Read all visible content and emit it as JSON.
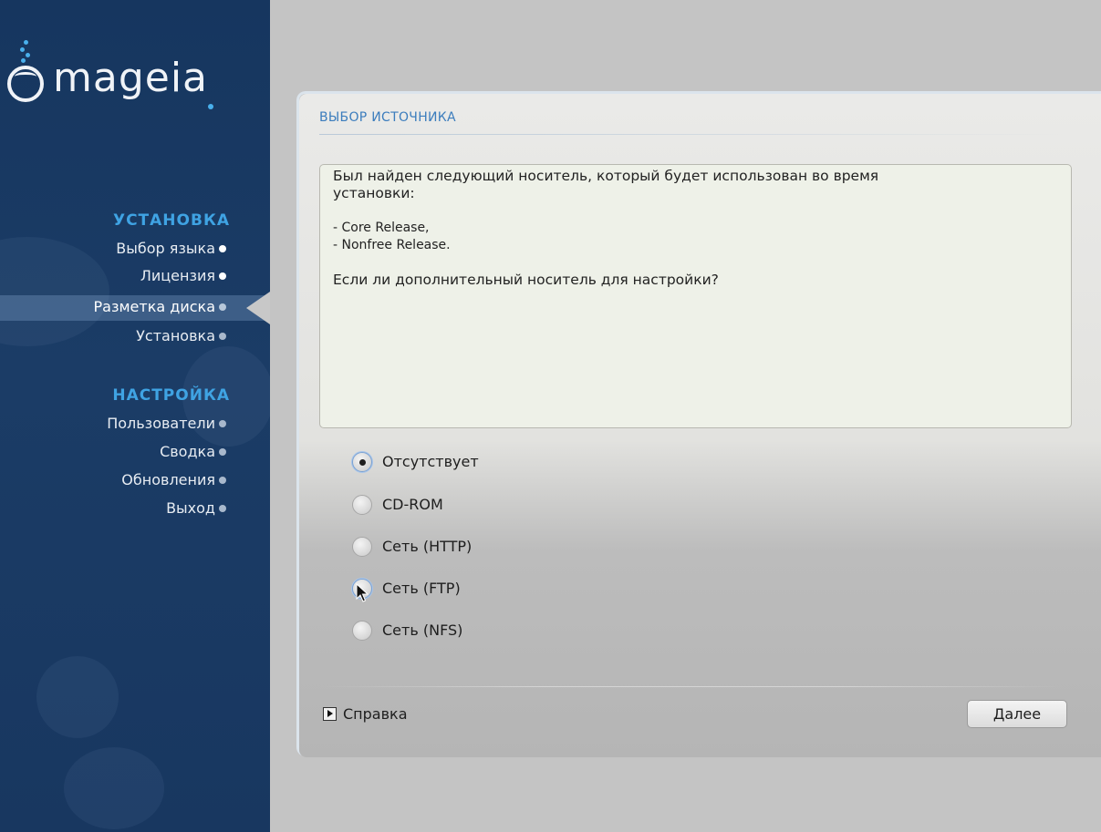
{
  "window": {
    "title": ""
  },
  "brand": {
    "logo_text": "mageia"
  },
  "sidebar": {
    "sections": [
      {
        "title": "УСТАНОВКА",
        "items": [
          {
            "label": "Выбор языка",
            "state": "done"
          },
          {
            "label": "Лицензия",
            "state": "done"
          },
          {
            "label": "Разметка диска",
            "state": "active"
          },
          {
            "label": "Установка",
            "state": "pending"
          }
        ]
      },
      {
        "title": "НАСТРОЙКА",
        "items": [
          {
            "label": "Пользователи",
            "state": "pending"
          },
          {
            "label": "Сводка",
            "state": "pending"
          },
          {
            "label": "Обновления",
            "state": "pending"
          },
          {
            "label": "Выход",
            "state": "pending"
          }
        ]
      }
    ]
  },
  "dialog": {
    "title": "ВЫБОР ИСТОЧНИКА",
    "message": {
      "line1": "Был найден следующий носитель, который будет использован во время",
      "line2": "установки:",
      "media1": "- Core Release,",
      "media2": "- Nonfree Release.",
      "question": "Если ли дополнительный носитель для настройки?"
    },
    "options": [
      {
        "label": "Отсутствует",
        "checked": true
      },
      {
        "label": "CD-ROM",
        "checked": false
      },
      {
        "label": "Сеть (HTTP)",
        "checked": false
      },
      {
        "label": "Сеть (FTP)",
        "checked": false
      },
      {
        "label": "Сеть (NFS)",
        "checked": false
      }
    ],
    "help_label": "Справка",
    "next_label": "Далее"
  },
  "colors": {
    "sidebar_bg": "#1b3c66",
    "section_title": "#3fa3e3",
    "dialog_title": "#3c7dbd",
    "panel_bg": "#e2e2df"
  }
}
